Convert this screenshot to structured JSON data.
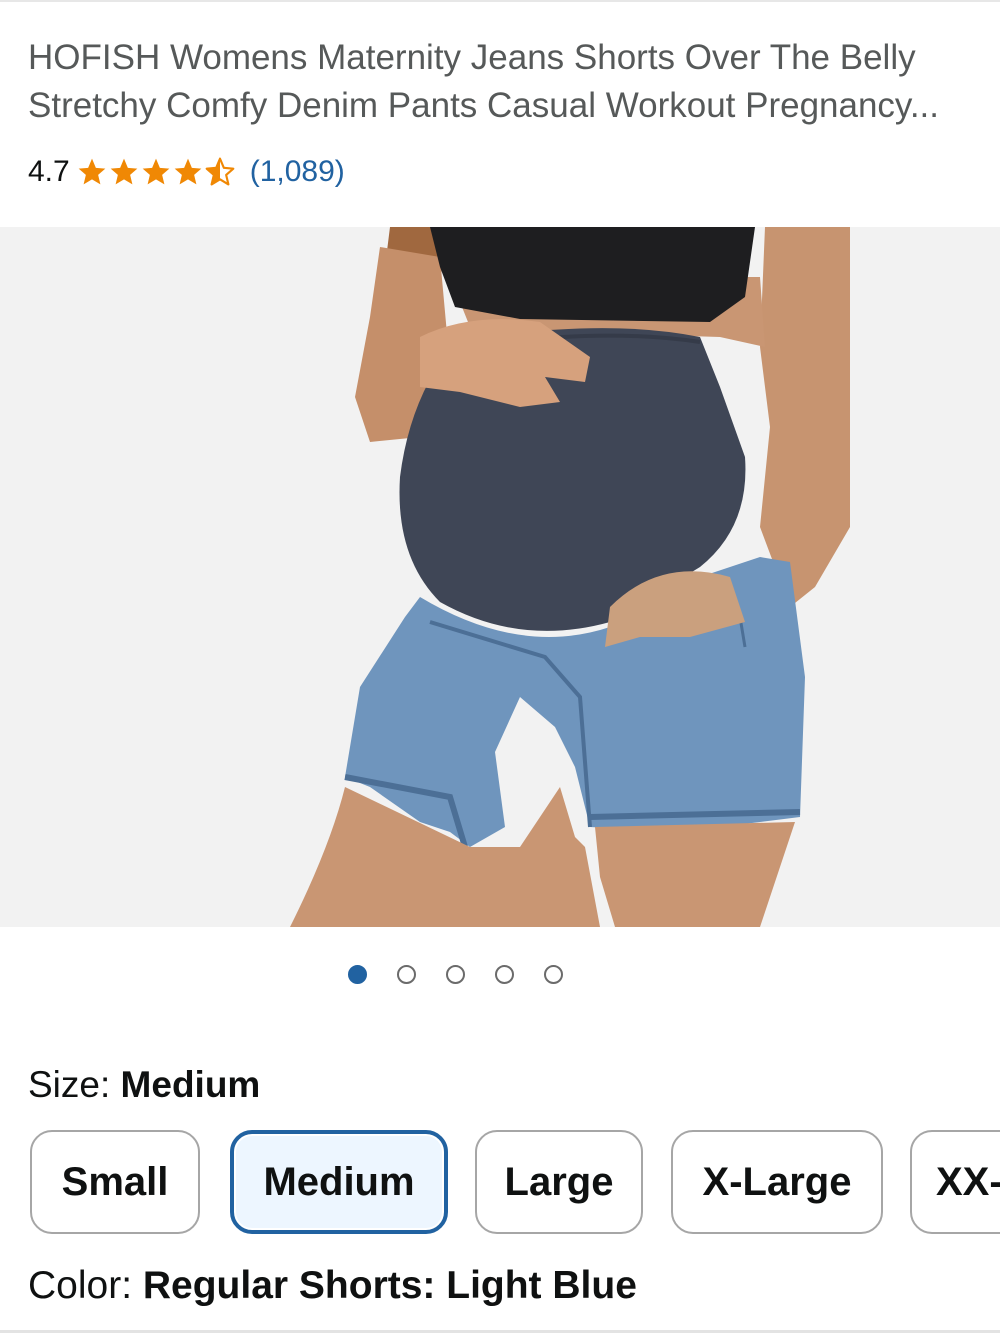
{
  "product": {
    "title_line1": "HOFISH Womens Maternity Jeans Shorts Over The Belly",
    "title_line2": "Stretchy Comfy Denim Pants Casual Workout Pregnancy...",
    "rating_value": "4.7",
    "rating_stars": 4.5,
    "rating_count": "(1,089)",
    "image_alt": "Maternity denim shorts with over-the-belly panel"
  },
  "gallery": {
    "total_images": 5,
    "active_index": 0
  },
  "size": {
    "label": "Size: ",
    "selected": "Medium",
    "options": [
      "Small",
      "Medium",
      "Large",
      "X-Large",
      "XX-Large"
    ]
  },
  "color": {
    "label": "Color: ",
    "selected": "Regular Shorts: Light Blue"
  },
  "colors": {
    "star": "#f08804",
    "link": "#2162a1",
    "selected_border": "#2162a1",
    "selected_bg": "#edf6ff"
  }
}
